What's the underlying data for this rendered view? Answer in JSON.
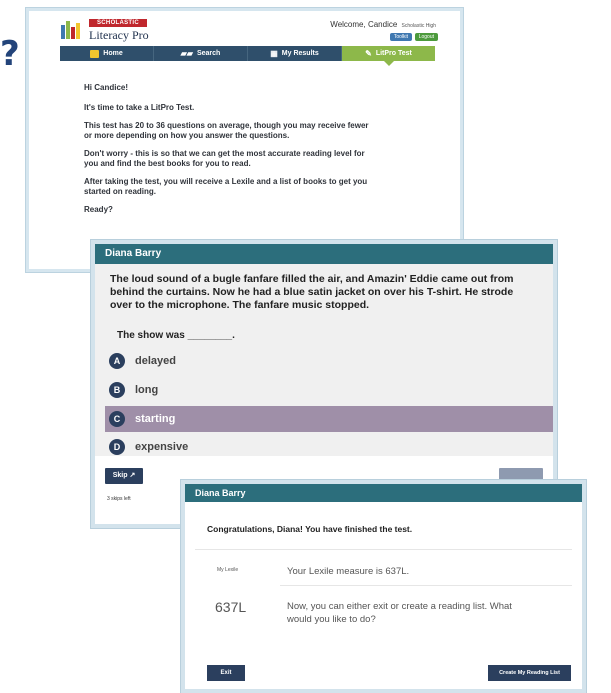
{
  "decor": {
    "question_mark": "?"
  },
  "panel1": {
    "brand_band": "SCHOLASTIC",
    "app_title": "Literacy Pro",
    "welcome": "Welcome, Candice",
    "school": "Scholastic High",
    "toolkit_label": "Toolkit",
    "logout_label": "Logout",
    "nav": [
      {
        "label": "Home",
        "icon": "home-icon"
      },
      {
        "label": "Search",
        "icon": "book-icon"
      },
      {
        "label": "My Results",
        "icon": "results-icon"
      },
      {
        "label": "LitPro Test",
        "icon": "pencil-icon"
      }
    ],
    "active_tab": "LitPro Test",
    "greeting": "Hi Candice!",
    "paragraphs": [
      "It's time to take a LitPro Test.",
      "This test has 20 to 36 questions on average, though you may receive fewer or more depending on how you answer the questions.",
      "Don't worry - this is so that we can get the most accurate reading level for you and find the best books for you to read.",
      "After taking the test, you will receive a Lexile and a list of books to get you started on reading.",
      "Ready?"
    ]
  },
  "panel2": {
    "student_name": "Diana Barry",
    "passage": "The loud sound of a bugle fanfare filled the air, and Amazin' Eddie came out from behind the curtains. Now he had a blue satin jacket on over his T-shirt. He strode over to the microphone. The fanfare music stopped.",
    "stem": "The show was ________.",
    "options": [
      {
        "letter": "A",
        "text": "delayed"
      },
      {
        "letter": "B",
        "text": "long"
      },
      {
        "letter": "C",
        "text": "starting"
      },
      {
        "letter": "D",
        "text": "expensive"
      }
    ],
    "selected_option": "C",
    "skip_label": "Skip",
    "skips_left": "3 skips left"
  },
  "panel3": {
    "student_name": "Diana Barry",
    "congrats": "Congratulations, Diana! You have finished the test.",
    "lexile_label": "My Lexile",
    "lexile_message": "Your Lexile measure is 637L.",
    "lexile_value": "637L",
    "next_message": "Now, you can either exit or create a reading list. What would you like to do?",
    "exit_label": "Exit",
    "create_label": "Create My Reading List"
  },
  "colors": {
    "nav_bg": "#2f4f6b",
    "nav_active": "#8db84a",
    "teal": "#2c6e7c",
    "navy_button": "#2b3f5e",
    "selected_option": "#9f8fa8"
  }
}
